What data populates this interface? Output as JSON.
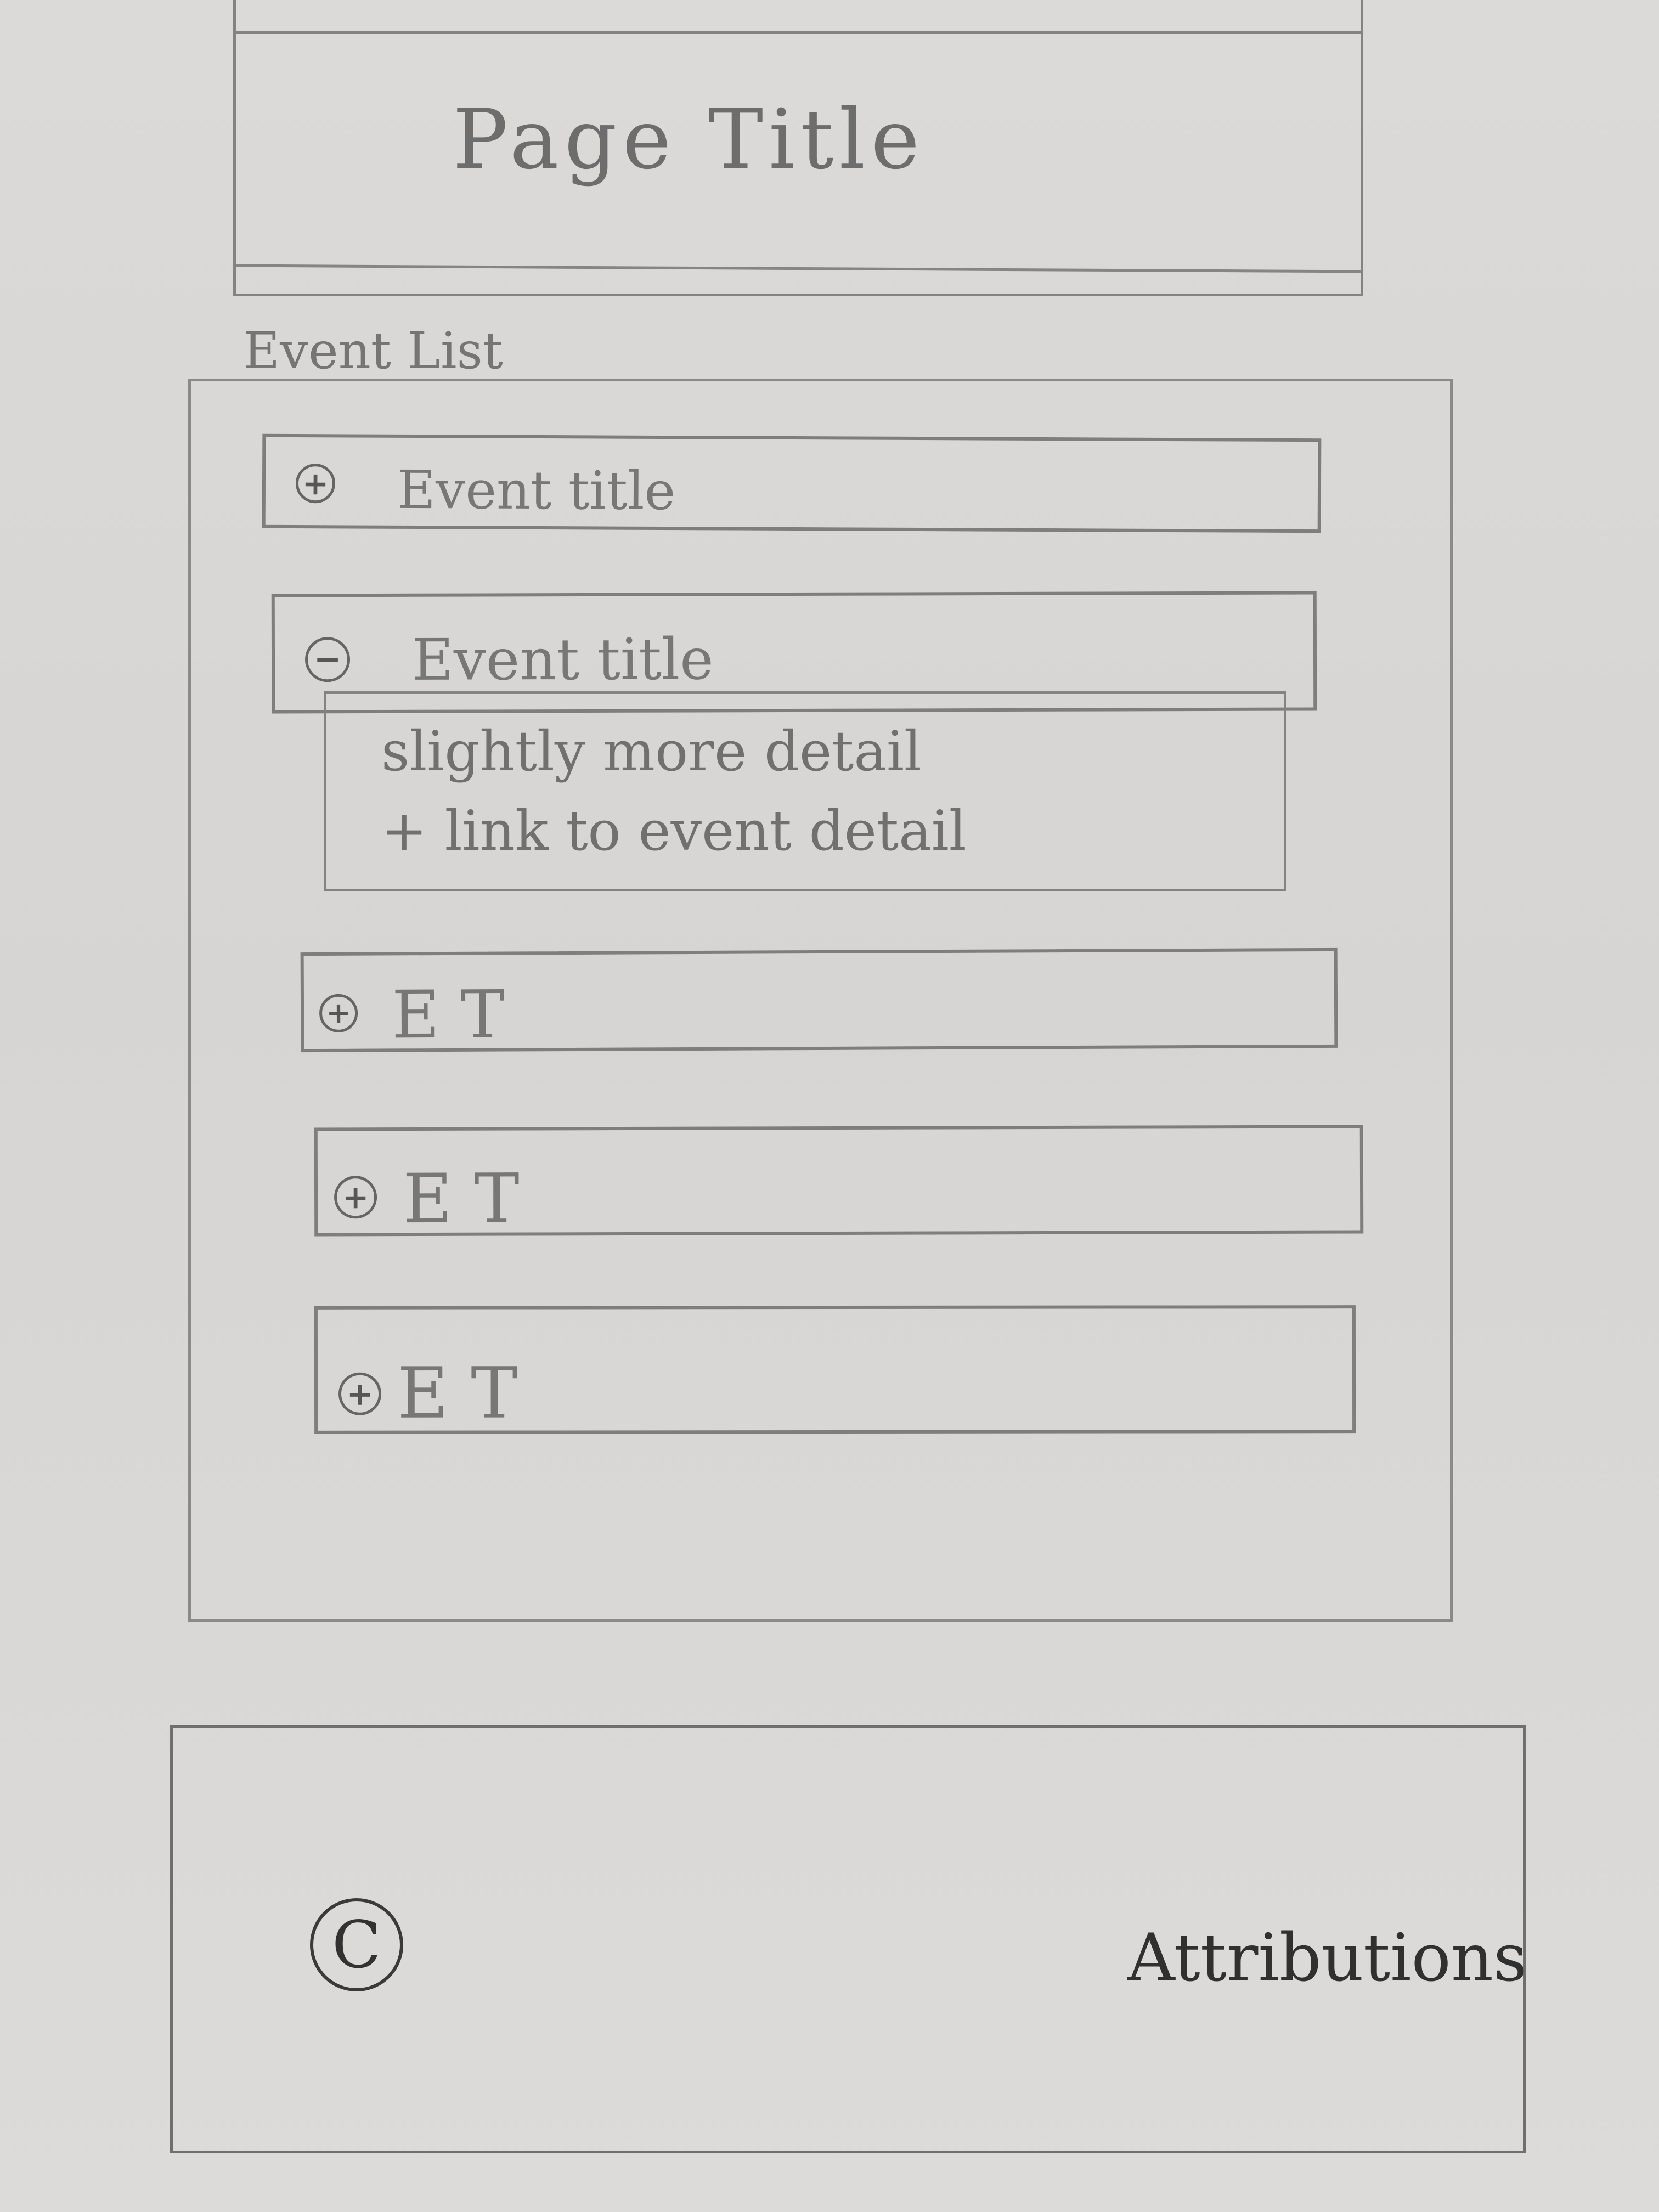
{
  "page": {
    "title": "Page Title"
  },
  "event_list": {
    "label": "Event List",
    "items": [
      {
        "icon": "plus-icon",
        "title": "Event title",
        "expanded": false
      },
      {
        "icon": "minus-icon",
        "title": "Event title",
        "expanded": true,
        "details": [
          "slightly more detail",
          "+ link to event detail"
        ]
      },
      {
        "icon": "plus-icon",
        "title": "E T",
        "expanded": false
      },
      {
        "icon": "plus-icon",
        "title": "E T",
        "expanded": false
      },
      {
        "icon": "plus-icon",
        "title": "E T",
        "expanded": false
      }
    ]
  },
  "footer": {
    "copyright_symbol": "C",
    "attributions": "Attributions"
  }
}
